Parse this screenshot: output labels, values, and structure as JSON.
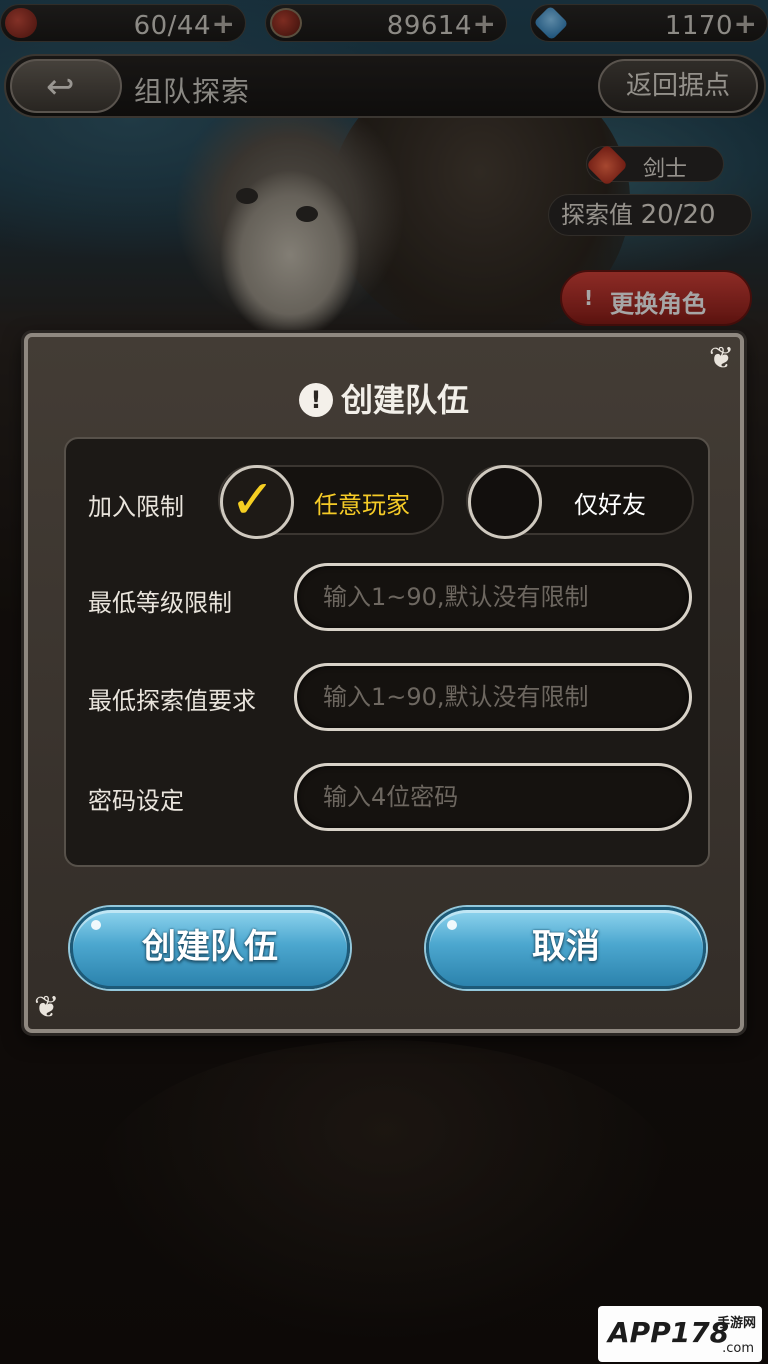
{
  "resources": [
    {
      "icon": "stamina-icon",
      "value": "60/44",
      "plus": "+"
    },
    {
      "icon": "coin-icon",
      "value": "89614",
      "plus": "+"
    },
    {
      "icon": "gem-icon",
      "value": "1170",
      "plus": "+"
    }
  ],
  "header": {
    "back_icon": "back-arrow-icon",
    "back_glyph": "↩",
    "title": "组队探索",
    "return_label": "返回据点"
  },
  "side": {
    "class_icon": "fire-icon",
    "class_label": "剑士",
    "explore_label": "探索值",
    "explore_value": "20/20",
    "change_label": "更换角色"
  },
  "dialog": {
    "title": "创建队伍",
    "title_icon": "exclamation-icon",
    "join_label": "加入限制",
    "options": [
      {
        "label": "任意玩家",
        "selected": true
      },
      {
        "label": "仅好友",
        "selected": false
      }
    ],
    "check_glyph": "✓",
    "min_level_label": "最低等级限制",
    "min_level_placeholder": "输入1~90,默认没有限制",
    "min_explore_label": "最低探索值要求",
    "min_explore_placeholder": "输入1~90,默认没有限制",
    "password_label": "密码设定",
    "password_placeholder": "输入4位密码",
    "create_label": "创建队伍",
    "cancel_label": "取消"
  },
  "watermark": {
    "brand": "APP178",
    "sub": "手游网",
    "domain": ".com"
  },
  "colors": {
    "accent_yellow": "#f5cb27",
    "button_blue": "#4ca7cf",
    "change_red": "#d9433a"
  }
}
